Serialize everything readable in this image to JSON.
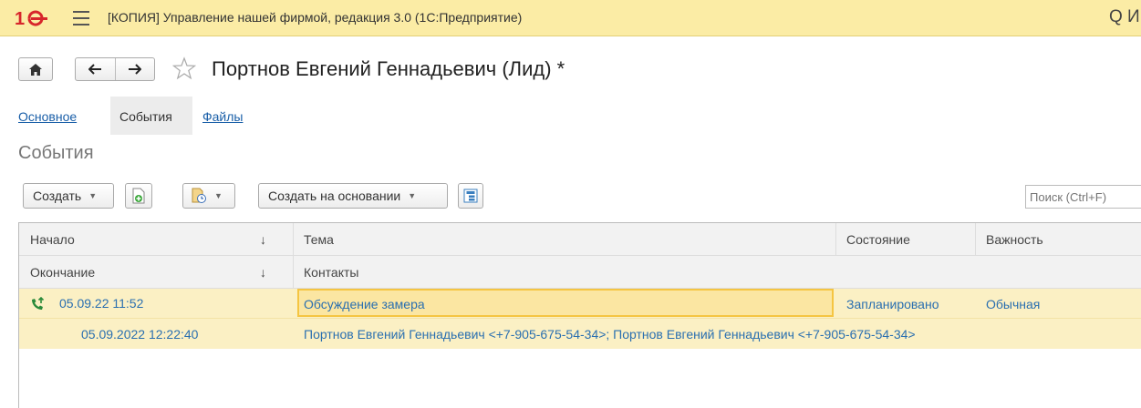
{
  "app": {
    "title": "[КОПИЯ] Управление нашей фирмой, редакция 3.0  (1С:Предприятие)",
    "search_glyph": "Q И"
  },
  "nav": {
    "document_title": "Портнов Евгений Геннадьевич (Лид) *"
  },
  "tabs": [
    {
      "label": "Основное",
      "active": false
    },
    {
      "label": "События",
      "active": true
    },
    {
      "label": "Файлы",
      "active": false
    }
  ],
  "section_title": "События",
  "toolbar": {
    "create_label": "Создать",
    "create_based_label": "Создать на основании",
    "search_placeholder": "Поиск (Ctrl+F)"
  },
  "table": {
    "header1": {
      "start": "Начало",
      "topic": "Тема",
      "state": "Состояние",
      "importance": "Важность",
      "sort_glyph": "↓"
    },
    "header2": {
      "end": "Окончание",
      "contacts": "Контакты",
      "sort_glyph": "↓"
    },
    "rows": [
      {
        "start": "05.09.22 11:52",
        "topic": "Обсуждение замера",
        "state": "Запланировано",
        "importance": "Обычная",
        "end": "05.09.2022 12:22:40",
        "contacts": "Портнов Евгений Геннадьевич <+7-905-675-54-34>; Портнов Евгений Геннадьевич <+7-905-675-54-34>"
      }
    ]
  },
  "colors": {
    "titlebar": "#fbeca5",
    "row_highlight": "#fbf0c4",
    "link": "#1a5fa8",
    "focus_border": "#f5c542",
    "logo_red": "#d7262b"
  },
  "icons": [
    "logo-1c",
    "menu-icon",
    "home-icon",
    "arrow-left-icon",
    "arrow-right-icon",
    "star-icon",
    "add-document-icon",
    "document-clock-icon",
    "hierarchy-icon",
    "phone-outgoing-icon"
  ]
}
